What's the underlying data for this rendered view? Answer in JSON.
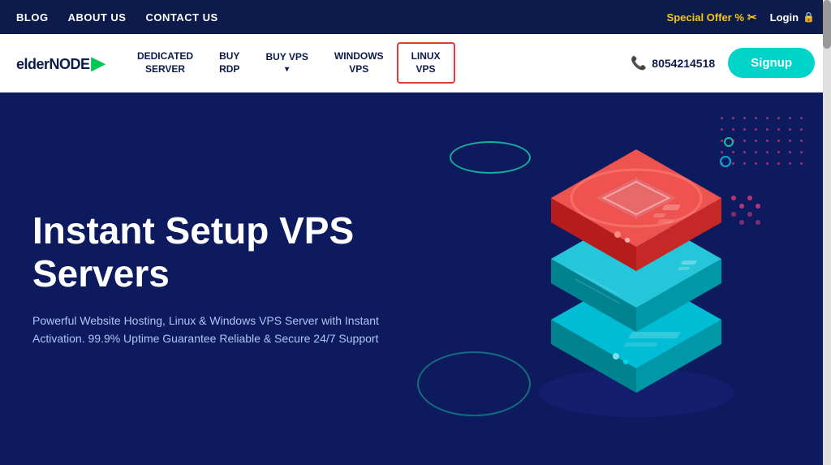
{
  "topbar": {
    "blog_label": "BLOG",
    "about_label": "ABOUT US",
    "contact_label": "CONTACT US",
    "special_offer_label": "Special Offer %",
    "login_label": "Login"
  },
  "nav": {
    "logo_text_main": "elder",
    "logo_text_node": "NODE",
    "dedicated_server_label": "DEDICATED\nSERVER",
    "buy_rdp_label": "BUY\nRDP",
    "buy_vps_label": "BUY VPS",
    "windows_vps_label": "WINDOWS\nVPS",
    "linux_vps_label": "LINUX\nVPS",
    "phone_number": "8054214518",
    "signup_label": "Signup"
  },
  "hero": {
    "title": "Instant Setup VPS Servers",
    "description": "Powerful Website Hosting, Linux & Windows VPS Server with Instant Activation. 99.9% Uptime Guarantee Reliable & Secure 24/7 Support"
  }
}
